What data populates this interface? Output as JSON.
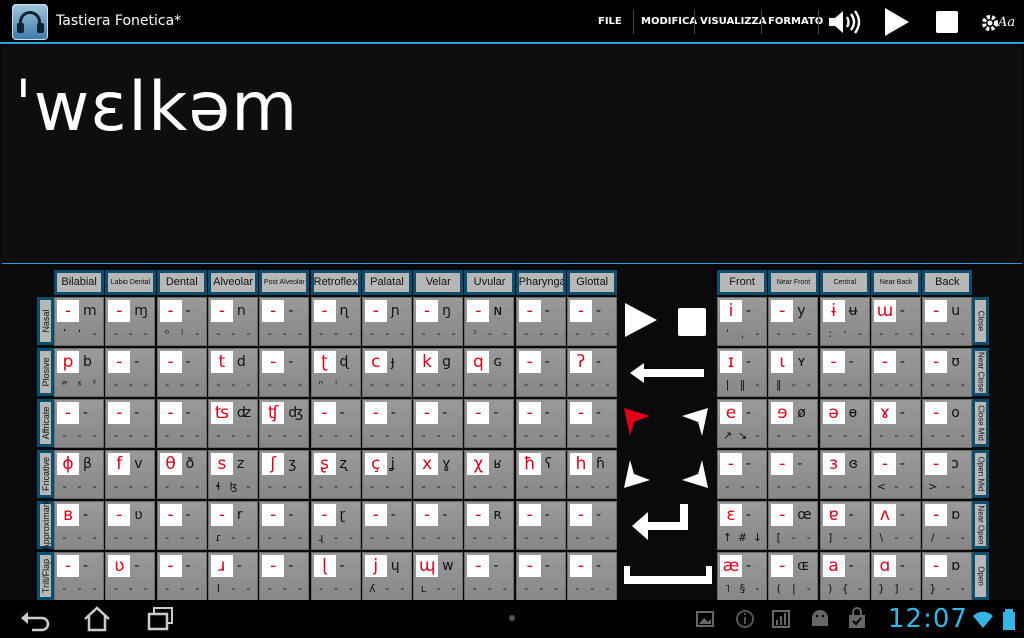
{
  "app": {
    "title": "Tastiera Fonetica*",
    "icon": "headphones-icon"
  },
  "menu": {
    "file": "FILE",
    "modifica": "MODIFICA",
    "visualizza": "VISUALIZZA",
    "formato": "FORMATO"
  },
  "toolbar_icons": [
    "speaker-icon",
    "play-icon",
    "stop-icon",
    "settings-font-icon"
  ],
  "settings_label": "Aa",
  "editor": {
    "text": "ˈwɛlkəm"
  },
  "consonant_columns": [
    "Bilabial",
    "Labio Dental",
    "Dental",
    "Alveolar",
    "Post Alveolar",
    "Retroflex",
    "Palatal",
    "Velar",
    "Uvular",
    "Pharyngal",
    "Glottal"
  ],
  "consonant_rows": [
    "Nasal",
    "Plosive",
    "Affricate",
    "Fricative",
    "Approximant",
    "Trill/Flap"
  ],
  "consonants": [
    [
      [
        "-",
        "m",
        "ʼ ʻ"
      ],
      [
        "-",
        "ɱ",
        ""
      ],
      [
        "-",
        "-",
        "ᵒ ʲ"
      ],
      [
        "-",
        "n",
        ""
      ],
      [
        "-",
        "-",
        ""
      ],
      [
        "-",
        "ɳ",
        ""
      ],
      [
        "-",
        "ɲ",
        ""
      ],
      [
        "-",
        "ŋ",
        ""
      ],
      [
        "-",
        "ɴ",
        "ᵓ"
      ],
      [
        "-",
        "-",
        ""
      ],
      [
        "-",
        "-",
        ""
      ]
    ],
    [
      [
        "p",
        "b",
        "ʷ ˠ ˤ"
      ],
      [
        "-",
        "-",
        ""
      ],
      [
        "-",
        "-",
        ""
      ],
      [
        "t",
        "d",
        ""
      ],
      [
        "-",
        "-",
        ""
      ],
      [
        "ʈ",
        "ɖ",
        "ⁿ ˡ"
      ],
      [
        "c",
        "ɟ",
        ""
      ],
      [
        "k",
        "g",
        ""
      ],
      [
        "q",
        "ɢ",
        ""
      ],
      [
        "-",
        "-",
        ""
      ],
      [
        "ʔ",
        "-",
        ""
      ]
    ],
    [
      [
        "-",
        "-",
        ""
      ],
      [
        "-",
        "-",
        ""
      ],
      [
        "-",
        "-",
        ""
      ],
      [
        "ʦ",
        "ʣ",
        ""
      ],
      [
        "ʧ",
        "ʤ",
        ""
      ],
      [
        "-",
        "-",
        ""
      ],
      [
        "-",
        "-",
        ""
      ],
      [
        "-",
        "-",
        ""
      ],
      [
        "-",
        "-",
        ""
      ],
      [
        "-",
        "-",
        ""
      ],
      [
        "-",
        "-",
        ""
      ]
    ],
    [
      [
        "ɸ",
        "β",
        ""
      ],
      [
        "f",
        "v",
        ""
      ],
      [
        "θ",
        "ð",
        ""
      ],
      [
        "s",
        "z",
        "ɬ ɮ"
      ],
      [
        "ʃ",
        "ʒ",
        ""
      ],
      [
        "ʂ",
        "ʐ",
        ""
      ],
      [
        "ç",
        "ʝ",
        ""
      ],
      [
        "x",
        "ɣ",
        ""
      ],
      [
        "χ",
        "ʁ",
        ""
      ],
      [
        "ħ",
        "ʕ",
        ""
      ],
      [
        "h",
        "ɦ",
        ""
      ]
    ],
    [
      [
        "ʙ",
        "-",
        ""
      ],
      [
        "-",
        "ʋ",
        ""
      ],
      [
        "-",
        "-",
        ""
      ],
      [
        "-",
        "r",
        "ɾ"
      ],
      [
        "-",
        "-",
        ""
      ],
      [
        "-",
        "ɽ",
        "ɻ"
      ],
      [
        "-",
        "-",
        ""
      ],
      [
        "-",
        "-",
        ""
      ],
      [
        "-",
        "ʀ",
        ""
      ],
      [
        "-",
        "-",
        ""
      ],
      [
        "-",
        "-",
        ""
      ]
    ],
    [
      [
        "-",
        "-",
        ""
      ],
      [
        "ʋ",
        "-",
        ""
      ],
      [
        "-",
        "-",
        ""
      ],
      [
        "ɹ",
        "-",
        "l"
      ],
      [
        "-",
        "-",
        ""
      ],
      [
        "ɭ",
        "-",
        ""
      ],
      [
        "j",
        "ɥ",
        "ʎ"
      ],
      [
        "ɰ",
        "w",
        "ʟ"
      ],
      [
        "-",
        "-",
        ""
      ],
      [
        "-",
        "-",
        ""
      ],
      [
        "-",
        "-",
        ""
      ]
    ]
  ],
  "vowel_columns": [
    "Front",
    "Near Front",
    "Central",
    "Near Back",
    "Back"
  ],
  "vowel_rows": [
    "Close",
    "Near Close",
    "Close Mid",
    "Open Mid",
    "Near Open",
    "Open"
  ],
  "vowels": [
    [
      [
        "i",
        "-",
        "ˈ ˌ"
      ],
      [
        "-",
        "y",
        ""
      ],
      [
        "ɨ",
        "ʉ",
        ": ˑ"
      ],
      [
        "ɯ",
        "-",
        ""
      ],
      [
        "-",
        "u",
        ""
      ]
    ],
    [
      [
        "ɪ",
        "-",
        "| ‖"
      ],
      [
        "ɩ",
        "ʏ",
        "‖"
      ],
      [
        "-",
        "-",
        ""
      ],
      [
        "-",
        "-",
        ""
      ],
      [
        "-",
        "ʊ",
        ""
      ]
    ],
    [
      [
        "e",
        "-",
        "↗ ↘"
      ],
      [
        "ɘ",
        "ø",
        ""
      ],
      [
        "ə",
        "ɵ",
        ""
      ],
      [
        "ɤ",
        "-",
        ""
      ],
      [
        "-",
        "o",
        ""
      ]
    ],
    [
      [
        "-",
        "-",
        ""
      ],
      [
        "-",
        "-",
        ""
      ],
      [
        "ɜ",
        "ɞ",
        ""
      ],
      [
        "-",
        "-",
        "<"
      ],
      [
        "-",
        "ɔ",
        ">"
      ]
    ],
    [
      [
        "ɛ",
        "-",
        "↑ # ↓"
      ],
      [
        "-",
        "œ",
        "["
      ],
      [
        "ɐ",
        "-",
        "]"
      ],
      [
        "ʌ",
        "-",
        "\\"
      ],
      [
        "-",
        "ɒ",
        "/"
      ]
    ],
    [
      [
        "æ",
        "-",
        "˥ §"
      ],
      [
        "-",
        "ɶ",
        "( |"
      ],
      [
        "a",
        "-",
        ") {"
      ],
      [
        "ɑ",
        "-",
        "} ]"
      ],
      [
        "-",
        "ɒ",
        "}"
      ]
    ]
  ],
  "controls": [
    "play-icon",
    "stop-icon",
    "backspace-arrow-icon",
    "cursor-arrows-icon",
    "enter-icon",
    "space-icon"
  ],
  "status": {
    "time": "12:07"
  }
}
